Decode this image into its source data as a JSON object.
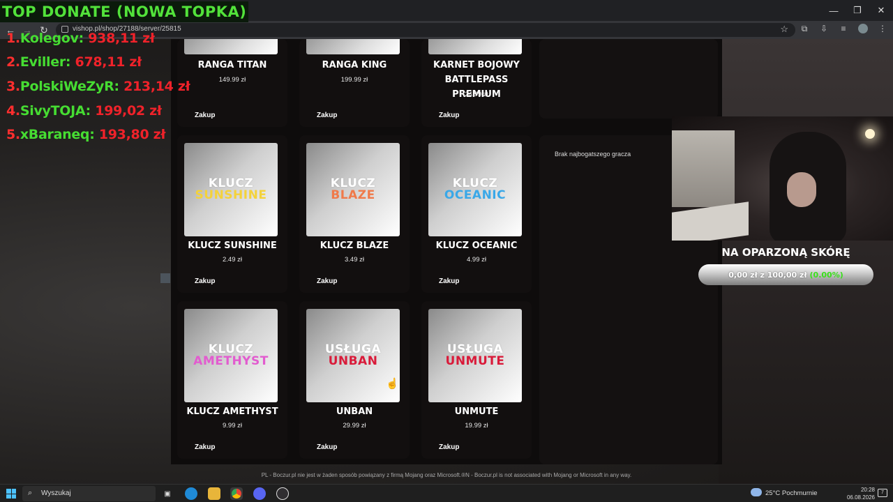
{
  "browser": {
    "url": "vishop.pl/shop/27188/server/25815",
    "window_controls": [
      "—",
      "❐",
      "✕"
    ]
  },
  "overlay": {
    "title": "TOP DONATE (NOWA TOPKA)",
    "donors": [
      {
        "rank": "1.",
        "name": "Kolegov:",
        "amount": "938,11 zł"
      },
      {
        "rank": "2.",
        "name": "Eviller:",
        "amount": "678,11 zł"
      },
      {
        "rank": "3.",
        "name": "PolskiWeZyR:",
        "amount": "213,14 zł"
      },
      {
        "rank": "4.",
        "name": "SivyTOJA:",
        "amount": "199,02 zł"
      },
      {
        "rank": "5.",
        "name": "xBaraneq:",
        "amount": "193,80 zł"
      }
    ],
    "goal": {
      "title": "NA OPARZONĄ SKÓRĘ",
      "progress_text": "0,00 zł z 100,00 zł",
      "percent_text": "(0.00%)",
      "progress_fraction": 0.0
    }
  },
  "shop": {
    "buy_label": "Zakup",
    "products": [
      {
        "name": "RANGA TITAN",
        "price": "149.99 zł"
      },
      {
        "name": "RANGA KING",
        "price": "199.99 zł"
      },
      {
        "name_line1": "KARNET BOJOWY",
        "name_line2": "BATTLEPASS PREMIUM",
        "price": "24.99 zł"
      },
      {
        "name": "KLUCZ SUNSHINE",
        "price": "2.49 zł",
        "img_top": "KLUCZ",
        "img_bottom": "SUNSHINE",
        "img_color": "#f4d23a"
      },
      {
        "name": "KLUCZ BLAZE",
        "price": "3.49 zł",
        "img_top": "KLUCZ",
        "img_bottom": "BLAZE",
        "img_color": "#f07a4a"
      },
      {
        "name": "KLUCZ OCEANIC",
        "price": "4.99 zł",
        "img_top": "KLUCZ",
        "img_bottom": "OCEANIC",
        "img_color": "#3aa8e8"
      },
      {
        "name": "KLUCZ AMETHYST",
        "price": "9.99 zł",
        "img_top": "KLUCZ",
        "img_bottom": "AMETHYST",
        "img_color": "#e25ccf"
      },
      {
        "name": "UNBAN",
        "price": "29.99 zł",
        "img_top": "USŁUGA",
        "img_bottom": "UNBAN",
        "img_color": "#d91b3a"
      },
      {
        "name": "UNMUTE",
        "price": "19.99 zł",
        "img_top": "USŁUGA",
        "img_bottom": "UNMUTE",
        "img_color": "#d91b3a"
      }
    ],
    "richest_player": "Brak najbogatszego gracza",
    "footer": "PL - Boczur.pl nie jest w żaden sposób powiązany z firmą Mojang oraz Microsoft.®N - Boczur.pl is not associated with Mojang or Microsoft in any way."
  },
  "taskbar": {
    "search_placeholder": "Wyszukaj",
    "weather": "25°C  Pochmurnie",
    "time": "20:28",
    "date": "06.08.2026",
    "notifications": "7"
  }
}
